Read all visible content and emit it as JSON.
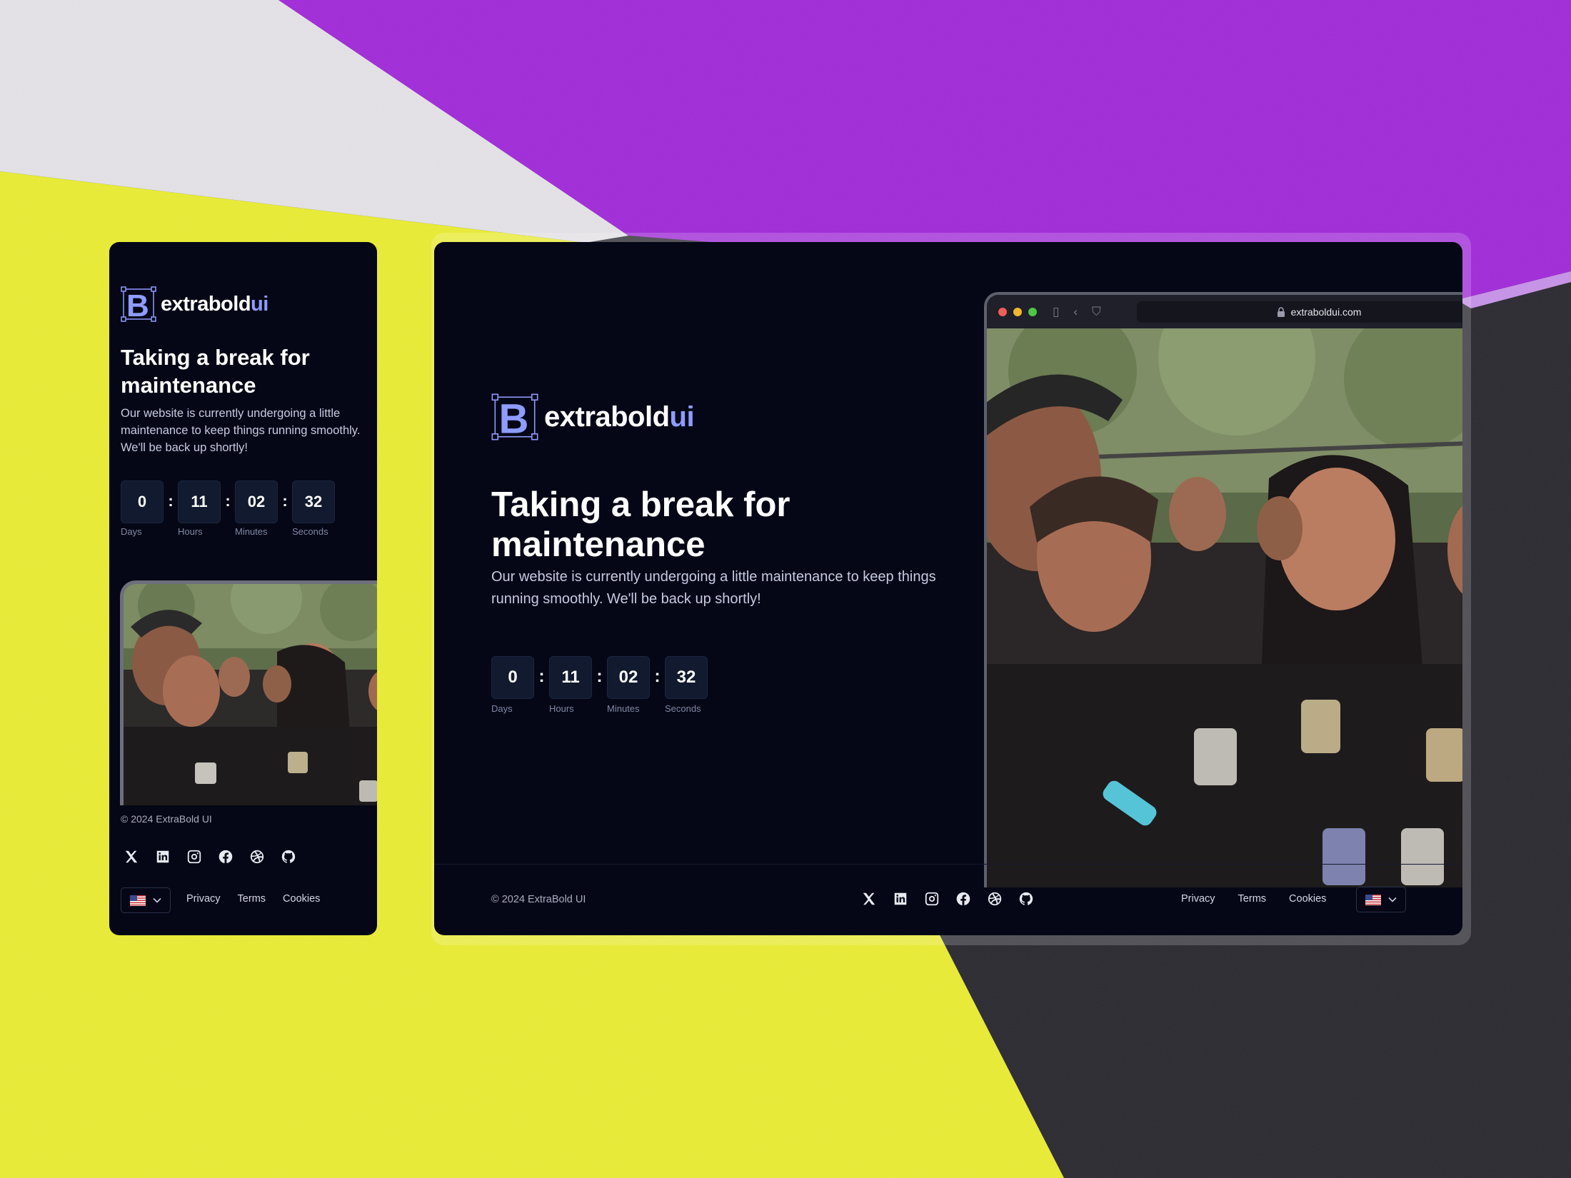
{
  "brand": {
    "name_main": "extrabold",
    "name_accent": "ui",
    "accent_color": "#8e9cff"
  },
  "hero": {
    "title": "Taking a break for maintenance",
    "description": "Our website is currently undergoing a little maintenance to keep things running smoothly. We'll be back up shortly!"
  },
  "countdown": {
    "days": "0",
    "hours": "11",
    "minutes": "02",
    "seconds": "32",
    "separator": ":",
    "days_label": "Days",
    "hours_label": "Hours",
    "minutes_label": "Minutes",
    "seconds_label": "Seconds"
  },
  "browser": {
    "url": "extraboldui.com"
  },
  "footer": {
    "copyright": "© 2024 ExtraBold UI",
    "links": {
      "privacy": "Privacy",
      "terms": "Terms",
      "cookies": "Cookies"
    },
    "social_icons": [
      "x-icon",
      "linkedin-icon",
      "instagram-icon",
      "facebook-icon",
      "dribbble-icon",
      "github-icon"
    ],
    "language_flag": "us-flag-icon"
  },
  "colors": {
    "page_bg": "#050716",
    "countdown_box": "#111a2e",
    "background_purple": "#a12bd9",
    "background_yellow": "#e9ec34",
    "background_grey": "#2b2a31"
  }
}
